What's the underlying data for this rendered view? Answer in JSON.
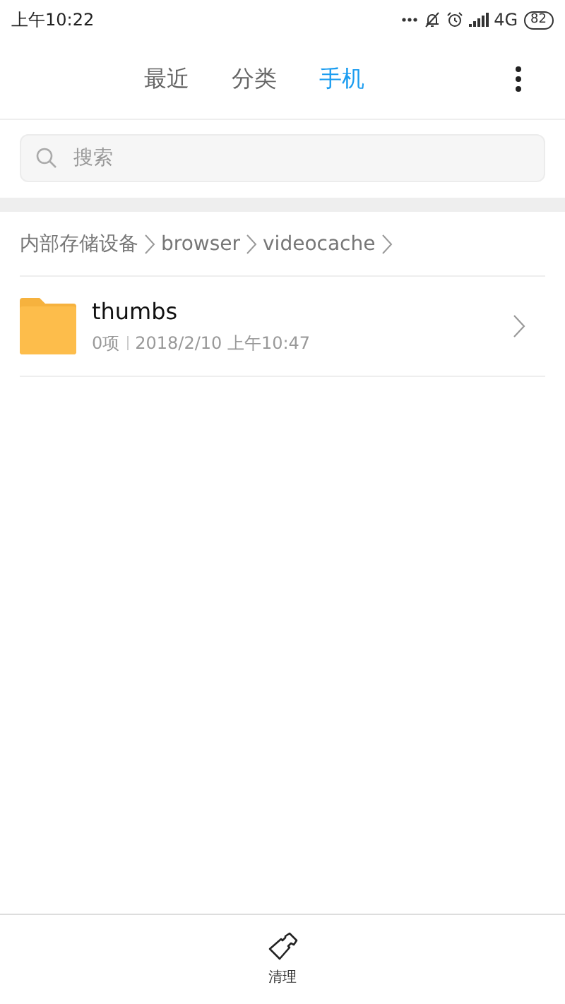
{
  "status_bar": {
    "time": "上午10:22",
    "network": "4G",
    "battery": "82"
  },
  "tabs": [
    {
      "label": "最近",
      "selected": false
    },
    {
      "label": "分类",
      "selected": false
    },
    {
      "label": "手机",
      "selected": true
    }
  ],
  "search": {
    "placeholder": "搜索"
  },
  "breadcrumb": [
    "内部存储设备",
    "browser",
    "videocache"
  ],
  "files": [
    {
      "name": "thumbs",
      "count": "0项",
      "date": "2018/2/10 上午10:47"
    }
  ],
  "bottom_bar": {
    "label": "清理"
  }
}
